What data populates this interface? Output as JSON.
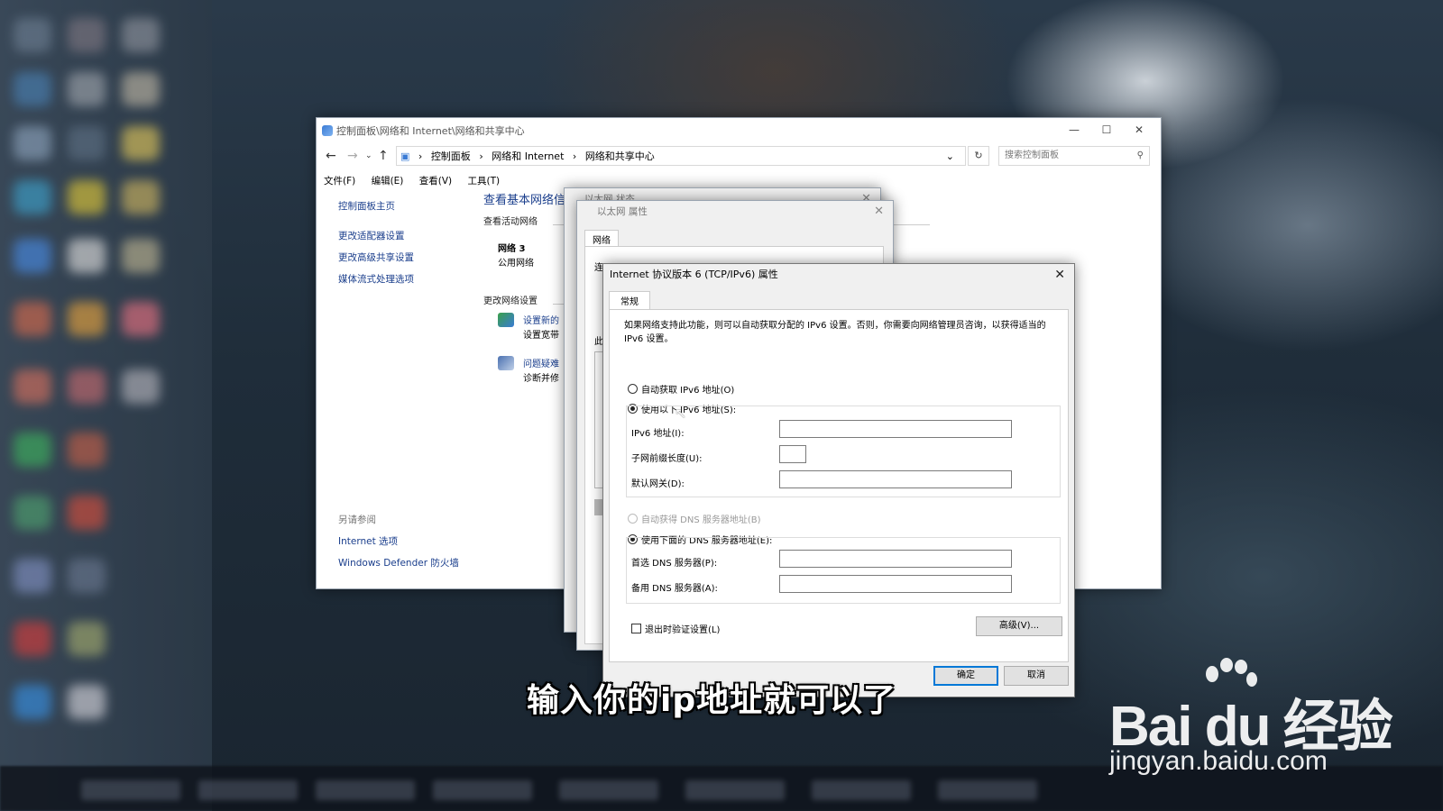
{
  "main_window": {
    "title": "控制面板\\网络和 Internet\\网络和共享中心",
    "breadcrumb": [
      "控制面板",
      "网络和 Internet",
      "网络和共享中心"
    ],
    "search_placeholder": "搜索控制面板",
    "menu": [
      "文件(F)",
      "编辑(E)",
      "查看(V)",
      "工具(T)"
    ],
    "sidebar": [
      "控制面板主页",
      "更改适配器设置",
      "更改高级共享设置",
      "媒体流式处理选项"
    ],
    "see_also_heading": "另请参阅",
    "see_also": [
      "Internet 选项",
      "Windows Defender 防火墙"
    ],
    "content": {
      "heading": "查看基本网络信",
      "active_networks": "查看活动网络",
      "network_name": "网络 3",
      "network_type": "公用网络",
      "change_settings": "更改网络设置",
      "setup_link": "设置新的",
      "setup_desc": "设置宽带",
      "troubleshoot_link": "问题疑难",
      "troubleshoot_desc": "诊断并修"
    }
  },
  "status_dialog": {
    "title": "以太网 状态"
  },
  "props_dialog": {
    "title": "以太网 属性",
    "tab": "网络",
    "label_conn": "连",
    "label_this": "此"
  },
  "ipv6_dialog": {
    "title": "Internet 协议版本 6 (TCP/IPv6) 属性",
    "tab": "常规",
    "description": "如果网络支持此功能，则可以自动获取分配的 IPv6 设置。否则，你需要向网络管理员咨询，以获得适当的 IPv6 设置。",
    "auto_ip": "自动获取 IPv6 地址(O)",
    "manual_ip": "使用以下 IPv6 地址(S):",
    "ipv6_address_label": "IPv6 地址(I):",
    "prefix_label": "子网前缀长度(U):",
    "gateway_label": "默认网关(D):",
    "auto_dns": "自动获得 DNS 服务器地址(B)",
    "manual_dns": "使用下面的 DNS 服务器地址(E):",
    "preferred_dns_label": "首选 DNS 服务器(P):",
    "alternate_dns_label": "备用 DNS 服务器(A):",
    "validate_label": "退出时验证设置(L)",
    "advanced_button": "高级(V)...",
    "ok_button": "确定",
    "cancel_button": "取消",
    "selected_ip_mode": "manual",
    "selected_dns_mode": "manual",
    "validate_checked": false
  },
  "subtitle": "输入你的ip地址就可以了",
  "watermark": {
    "logo_text": "Bai du 经验",
    "url": "jingyan.baidu.com"
  }
}
